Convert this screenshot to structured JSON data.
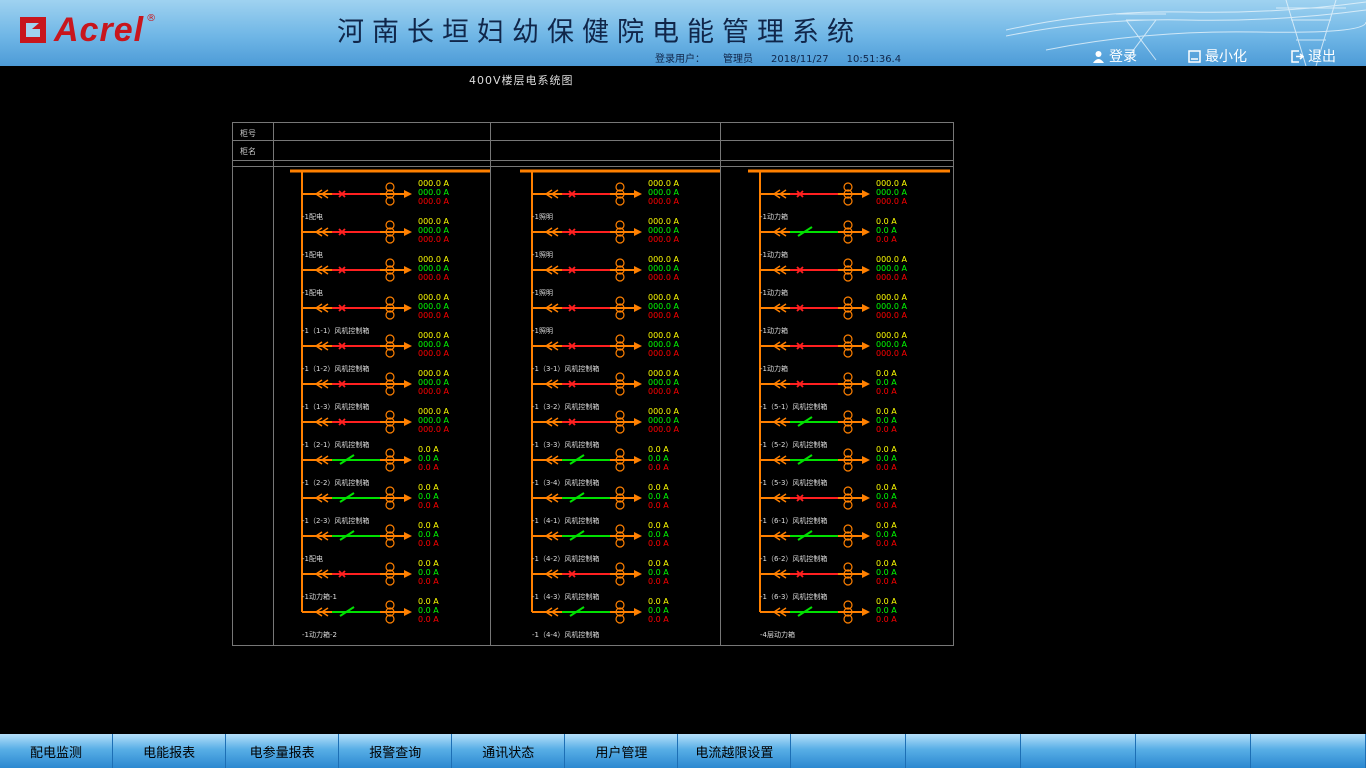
{
  "header": {
    "brand": "Acrel",
    "registered": "®",
    "title": "河南长垣妇幼保健院电能管理系统",
    "login_user_label": "登录用户：",
    "login_user": "管理员",
    "date": "2018/11/27",
    "time": "10:51:36.4",
    "login_btn": "登录",
    "minimize_btn": "最小化",
    "exit_btn": "退出"
  },
  "diagram": {
    "title": "400V楼层电系统图",
    "row_label_no": "柜号",
    "row_label_name": "柜名",
    "columns": [
      {
        "circuits": [
          {
            "label": "-1配电",
            "a1": "000.0 A",
            "a2": "000.0 A",
            "a3": "000.0 A",
            "cb": "red"
          },
          {
            "label": "-1配电",
            "a1": "000.0 A",
            "a2": "000.0 A",
            "a3": "000.0 A",
            "cb": "red"
          },
          {
            "label": "-1配电",
            "a1": "000.0 A",
            "a2": "000.0 A",
            "a3": "000.0 A",
            "cb": "red"
          },
          {
            "label": "-1（1-1）风机控制箱",
            "a1": "000.0 A",
            "a2": "000.0 A",
            "a3": "000.0 A",
            "cb": "red"
          },
          {
            "label": "-1（1-2）风机控制箱",
            "a1": "000.0 A",
            "a2": "000.0 A",
            "a3": "000.0 A",
            "cb": "red"
          },
          {
            "label": "-1（1-3）风机控制箱",
            "a1": "000.0 A",
            "a2": "000.0 A",
            "a3": "000.0 A",
            "cb": "red"
          },
          {
            "label": "-1（2-1）风机控制箱",
            "a1": "000.0 A",
            "a2": "000.0 A",
            "a3": "000.0 A",
            "cb": "red"
          },
          {
            "label": "-1（2-2）风机控制箱",
            "a1": "0.0 A",
            "a2": "0.0 A",
            "a3": "0.0 A",
            "cb": "green"
          },
          {
            "label": "-1（2-3）风机控制箱",
            "a1": "0.0 A",
            "a2": "0.0 A",
            "a3": "0.0 A",
            "cb": "green"
          },
          {
            "label": "-1配电",
            "a1": "0.0 A",
            "a2": "0.0 A",
            "a3": "0.0 A",
            "cb": "green"
          },
          {
            "label": "-1动力箱-1",
            "a1": "0.0 A",
            "a2": "0.0 A",
            "a3": "0.0 A",
            "cb": "red"
          },
          {
            "label": "-1动力箱-2",
            "a1": "0.0 A",
            "a2": "0.0 A",
            "a3": "0.0 A",
            "cb": "green"
          }
        ]
      },
      {
        "circuits": [
          {
            "label": "-1照明",
            "a1": "000.0 A",
            "a2": "000.0 A",
            "a3": "000.0 A",
            "cb": "red"
          },
          {
            "label": "-1照明",
            "a1": "000.0 A",
            "a2": "000.0 A",
            "a3": "000.0 A",
            "cb": "red"
          },
          {
            "label": "-1照明",
            "a1": "000.0 A",
            "a2": "000.0 A",
            "a3": "000.0 A",
            "cb": "red"
          },
          {
            "label": "-1照明",
            "a1": "000.0 A",
            "a2": "000.0 A",
            "a3": "000.0 A",
            "cb": "red"
          },
          {
            "label": "-1（3-1）风机控制箱",
            "a1": "000.0 A",
            "a2": "000.0 A",
            "a3": "000.0 A",
            "cb": "red"
          },
          {
            "label": "-1（3-2）风机控制箱",
            "a1": "000.0 A",
            "a2": "000.0 A",
            "a3": "000.0 A",
            "cb": "red"
          },
          {
            "label": "-1（3-3）风机控制箱",
            "a1": "000.0 A",
            "a2": "000.0 A",
            "a3": "000.0 A",
            "cb": "red"
          },
          {
            "label": "-1（3-4）风机控制箱",
            "a1": "0.0 A",
            "a2": "0.0 A",
            "a3": "0.0 A",
            "cb": "green"
          },
          {
            "label": "-1（4-1）风机控制箱",
            "a1": "0.0 A",
            "a2": "0.0 A",
            "a3": "0.0 A",
            "cb": "green"
          },
          {
            "label": "-1（4-2）风机控制箱",
            "a1": "0.0 A",
            "a2": "0.0 A",
            "a3": "0.0 A",
            "cb": "green"
          },
          {
            "label": "-1（4-3）风机控制箱",
            "a1": "0.0 A",
            "a2": "0.0 A",
            "a3": "0.0 A",
            "cb": "red"
          },
          {
            "label": "-1（4-4）风机控制箱",
            "a1": "0.0 A",
            "a2": "0.0 A",
            "a3": "0.0 A",
            "cb": "green"
          }
        ]
      },
      {
        "circuits": [
          {
            "label": "-1动力箱",
            "a1": "000.0 A",
            "a2": "000.0 A",
            "a3": "000.0 A",
            "cb": "red"
          },
          {
            "label": "-1动力箱",
            "a1": "0.0 A",
            "a2": "0.0 A",
            "a3": "0.0 A",
            "cb": "green"
          },
          {
            "label": "-1动力箱",
            "a1": "000.0 A",
            "a2": "000.0 A",
            "a3": "000.0 A",
            "cb": "red"
          },
          {
            "label": "-1动力箱",
            "a1": "000.0 A",
            "a2": "000.0 A",
            "a3": "000.0 A",
            "cb": "red"
          },
          {
            "label": "-1动力箱",
            "a1": "000.0 A",
            "a2": "000.0 A",
            "a3": "000.0 A",
            "cb": "red"
          },
          {
            "label": "-1（5-1）风机控制箱",
            "a1": "0.0 A",
            "a2": "0.0 A",
            "a3": "0.0 A",
            "cb": "red"
          },
          {
            "label": "-1（5-2）风机控制箱",
            "a1": "0.0 A",
            "a2": "0.0 A",
            "a3": "0.0 A",
            "cb": "green"
          },
          {
            "label": "-1（5-3）风机控制箱",
            "a1": "0.0 A",
            "a2": "0.0 A",
            "a3": "0.0 A",
            "cb": "green"
          },
          {
            "label": "-1（6-1）风机控制箱",
            "a1": "0.0 A",
            "a2": "0.0 A",
            "a3": "0.0 A",
            "cb": "red"
          },
          {
            "label": "-1（6-2）风机控制箱",
            "a1": "0.0 A",
            "a2": "0.0 A",
            "a3": "0.0 A",
            "cb": "green"
          },
          {
            "label": "-1（6-3）风机控制箱",
            "a1": "0.0 A",
            "a2": "0.0 A",
            "a3": "0.0 A",
            "cb": "red"
          },
          {
            "label": "-4层动力箱",
            "a1": "0.0 A",
            "a2": "0.0 A",
            "a3": "0.0 A",
            "cb": "green"
          }
        ]
      }
    ]
  },
  "tabs": [
    "配电监测",
    "电能报表",
    "电参量报表",
    "报警查询",
    "通讯状态",
    "用户管理",
    "电流越限设置",
    "",
    "",
    "",
    "",
    ""
  ],
  "colors": {
    "bus": "#ff8000",
    "phase_a": "#ffff00",
    "phase_b": "#00ff00",
    "phase_c": "#ff0000",
    "breaker_red": "#ff2020",
    "breaker_green": "#00e000"
  }
}
